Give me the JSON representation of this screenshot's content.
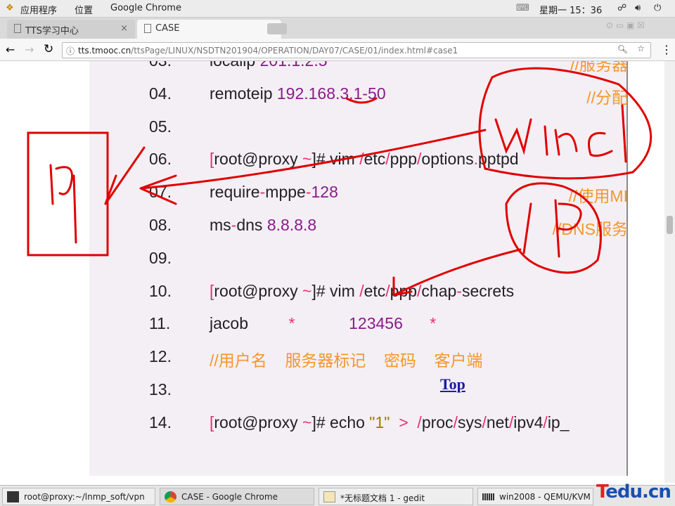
{
  "topbar": {
    "apps": "应用程序",
    "places": "位置",
    "active_app": "Google Chrome",
    "clock": "星期一 15：36"
  },
  "tabs": [
    {
      "label": "TTS学习中心"
    },
    {
      "label": "CASE"
    }
  ],
  "address": {
    "host": "tts.tmooc.cn",
    "path": "/ttsPage/LINUX/NSDTN201904/OPERATION/DAY07/CASE/01/index.html#case1"
  },
  "lines": [
    {
      "num": "03.",
      "segs": [
        [
          "",
          "localip "
        ],
        [
          "n",
          "201.1.2.5"
        ]
      ],
      "comment": "//服务器"
    },
    {
      "num": "04.",
      "segs": [
        [
          "",
          "remoteip "
        ],
        [
          "n",
          "192.168.3.1-50"
        ]
      ],
      "comment": "//分配"
    },
    {
      "num": "05.",
      "segs": [],
      "comment": ""
    },
    {
      "num": "06.",
      "segs": [
        [
          "p",
          "["
        ],
        [
          "",
          "root@proxy "
        ],
        [
          "p",
          "~"
        ],
        [
          "",
          "]# vim "
        ],
        [
          "p",
          "/"
        ],
        [
          "",
          "etc"
        ],
        [
          "p",
          "/"
        ],
        [
          "",
          "ppp"
        ],
        [
          "p",
          "/"
        ],
        [
          "",
          "options"
        ],
        [
          "p",
          "."
        ],
        [
          "",
          "pptpd"
        ]
      ],
      "comment": ""
    },
    {
      "num": "07.",
      "segs": [
        [
          "",
          "require"
        ],
        [
          "p",
          "-"
        ],
        [
          "",
          "mppe"
        ],
        [
          "p",
          "-"
        ],
        [
          "n",
          "128"
        ]
      ],
      "comment": "//使用MI"
    },
    {
      "num": "08.",
      "segs": [
        [
          "",
          "ms"
        ],
        [
          "p",
          "-"
        ],
        [
          "",
          "dns "
        ],
        [
          "n",
          "8.8.8.8"
        ]
      ],
      "comment": "//DNS服务"
    },
    {
      "num": "09.",
      "segs": [],
      "comment": ""
    },
    {
      "num": "10.",
      "segs": [
        [
          "p",
          "["
        ],
        [
          "",
          "root@proxy "
        ],
        [
          "p",
          "~"
        ],
        [
          "",
          "]# vim "
        ],
        [
          "p",
          "/"
        ],
        [
          "",
          "etc"
        ],
        [
          "p",
          "/"
        ],
        [
          "",
          "ppp"
        ],
        [
          "p",
          "/"
        ],
        [
          "",
          "chap"
        ],
        [
          "p",
          "-"
        ],
        [
          "",
          "secrets"
        ]
      ],
      "comment": ""
    },
    {
      "num": "11.",
      "segs": [
        [
          "",
          "jacob         "
        ],
        [
          "p",
          "*"
        ],
        [
          "",
          "            "
        ],
        [
          "n",
          "123456"
        ],
        [
          "",
          "      "
        ],
        [
          "p",
          "*"
        ]
      ],
      "comment": ""
    },
    {
      "num": "12.",
      "segs": [
        [
          "c",
          "//用户名    服务器标记    密码    客户端"
        ]
      ],
      "comment": ""
    },
    {
      "num": "13.",
      "segs": [],
      "comment": ""
    },
    {
      "num": "14.",
      "segs": [
        [
          "p",
          "["
        ],
        [
          "",
          "root@proxy "
        ],
        [
          "p",
          "~"
        ],
        [
          "",
          "]# echo "
        ],
        [
          "s",
          "\"1\""
        ],
        [
          "",
          "  "
        ],
        [
          "p",
          ">"
        ],
        [
          "",
          "  "
        ],
        [
          "p",
          "/"
        ],
        [
          "",
          "proc"
        ],
        [
          "p",
          "/"
        ],
        [
          "",
          "sys"
        ],
        [
          "p",
          "/"
        ],
        [
          "",
          "net"
        ],
        [
          "p",
          "/"
        ],
        [
          "",
          "ipv4"
        ],
        [
          "p",
          "/"
        ],
        [
          "",
          "ip_"
        ]
      ],
      "comment": ""
    }
  ],
  "top_link": "Top",
  "taskbar": [
    {
      "label": "root@proxy:~/lnmp_soft/vpn"
    },
    {
      "label": "CASE - Google Chrome"
    },
    {
      "label": "*无标题文档 1 - gedit"
    },
    {
      "label": "win2008 - QEMU/KVM"
    }
  ],
  "logo": "Tedu.cn",
  "annotation_color": "#e00000"
}
